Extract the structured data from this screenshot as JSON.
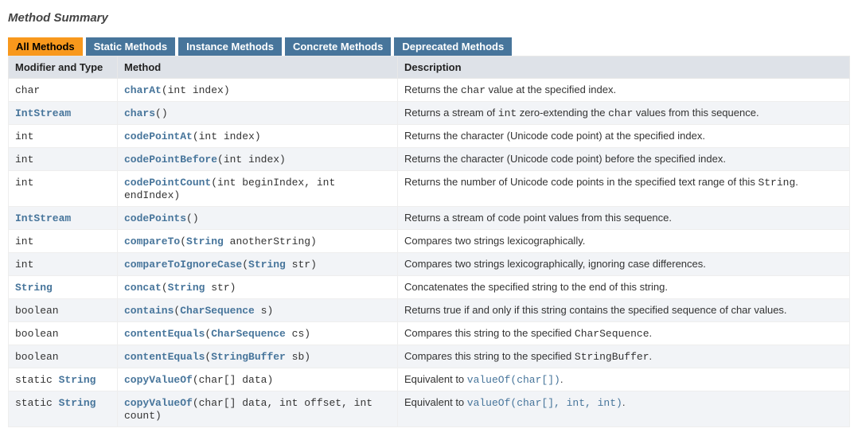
{
  "title": "Method Summary",
  "tabs": [
    {
      "label": "All Methods",
      "active": true
    },
    {
      "label": "Static Methods",
      "active": false
    },
    {
      "label": "Instance Methods",
      "active": false
    },
    {
      "label": "Concrete Methods",
      "active": false
    },
    {
      "label": "Deprecated Methods",
      "active": false
    }
  ],
  "headers": {
    "modifier": "Modifier and Type",
    "method": "Method",
    "description": "Description"
  },
  "rows": [
    {
      "modifier": [
        {
          "t": "char",
          "kind": "kw"
        }
      ],
      "method": {
        "name": "charAt",
        "sig": "(int index)",
        "params": []
      },
      "desc": [
        {
          "t": "Returns the "
        },
        {
          "t": "char",
          "code": true
        },
        {
          "t": " value at the specified index."
        }
      ]
    },
    {
      "modifier": [
        {
          "t": "IntStream",
          "kind": "link"
        }
      ],
      "method": {
        "name": "chars",
        "sig": "()",
        "params": []
      },
      "desc": [
        {
          "t": "Returns a stream of "
        },
        {
          "t": "int",
          "code": true
        },
        {
          "t": " zero-extending the "
        },
        {
          "t": "char",
          "code": true
        },
        {
          "t": " values from this sequence."
        }
      ]
    },
    {
      "modifier": [
        {
          "t": "int",
          "kind": "kw"
        }
      ],
      "method": {
        "name": "codePointAt",
        "sig": "(int index)",
        "params": []
      },
      "desc": [
        {
          "t": "Returns the character (Unicode code point) at the specified index."
        }
      ]
    },
    {
      "modifier": [
        {
          "t": "int",
          "kind": "kw"
        }
      ],
      "method": {
        "name": "codePointBefore",
        "sig": "(int index)",
        "params": []
      },
      "desc": [
        {
          "t": "Returns the character (Unicode code point) before the specified index."
        }
      ]
    },
    {
      "modifier": [
        {
          "t": "int",
          "kind": "kw"
        }
      ],
      "method": {
        "name": "codePointCount",
        "sig": "(int beginIndex, int endIndex)",
        "params": []
      },
      "desc": [
        {
          "t": "Returns the number of Unicode code points in the specified text range of this "
        },
        {
          "t": "String",
          "code": true
        },
        {
          "t": "."
        }
      ]
    },
    {
      "modifier": [
        {
          "t": "IntStream",
          "kind": "link"
        }
      ],
      "method": {
        "name": "codePoints",
        "sig": "()",
        "params": []
      },
      "desc": [
        {
          "t": "Returns a stream of code point values from this sequence."
        }
      ]
    },
    {
      "modifier": [
        {
          "t": "int",
          "kind": "kw"
        }
      ],
      "method": {
        "name": "compareTo",
        "sig": "",
        "params": [
          {
            "prefix": "(",
            "type": "String",
            "rest": " anotherString)"
          }
        ]
      },
      "desc": [
        {
          "t": "Compares two strings lexicographically."
        }
      ]
    },
    {
      "modifier": [
        {
          "t": "int",
          "kind": "kw"
        }
      ],
      "method": {
        "name": "compareToIgnoreCase",
        "sig": "",
        "params": [
          {
            "prefix": "(",
            "type": "String",
            "rest": " str)"
          }
        ]
      },
      "desc": [
        {
          "t": "Compares two strings lexicographically, ignoring case differences."
        }
      ]
    },
    {
      "modifier": [
        {
          "t": "String",
          "kind": "link"
        }
      ],
      "method": {
        "name": "concat",
        "sig": "",
        "params": [
          {
            "prefix": "(",
            "type": "String",
            "rest": " str)"
          }
        ]
      },
      "desc": [
        {
          "t": "Concatenates the specified string to the end of this string."
        }
      ]
    },
    {
      "modifier": [
        {
          "t": "boolean",
          "kind": "kw"
        }
      ],
      "method": {
        "name": "contains",
        "sig": "",
        "params": [
          {
            "prefix": "(",
            "type": "CharSequence",
            "rest": " s)"
          }
        ]
      },
      "desc": [
        {
          "t": "Returns true if and only if this string contains the specified sequence of char values."
        }
      ]
    },
    {
      "modifier": [
        {
          "t": "boolean",
          "kind": "kw"
        }
      ],
      "method": {
        "name": "contentEquals",
        "sig": "",
        "params": [
          {
            "prefix": "(",
            "type": "CharSequence",
            "rest": " cs)"
          }
        ]
      },
      "desc": [
        {
          "t": "Compares this string to the specified "
        },
        {
          "t": "CharSequence",
          "code": true
        },
        {
          "t": "."
        }
      ]
    },
    {
      "modifier": [
        {
          "t": "boolean",
          "kind": "kw"
        }
      ],
      "method": {
        "name": "contentEquals",
        "sig": "",
        "params": [
          {
            "prefix": "(",
            "type": "StringBuffer",
            "rest": " sb)"
          }
        ]
      },
      "desc": [
        {
          "t": "Compares this string to the specified "
        },
        {
          "t": "StringBuffer",
          "code": true
        },
        {
          "t": "."
        }
      ]
    },
    {
      "modifier": [
        {
          "t": "static ",
          "kind": "kw"
        },
        {
          "t": "String",
          "kind": "link"
        }
      ],
      "method": {
        "name": "copyValueOf",
        "sig": "(char[] data)",
        "params": []
      },
      "desc": [
        {
          "t": "Equivalent to "
        },
        {
          "t": "valueOf(char[])",
          "ref": true
        },
        {
          "t": "."
        }
      ]
    },
    {
      "modifier": [
        {
          "t": "static ",
          "kind": "kw"
        },
        {
          "t": "String",
          "kind": "link"
        }
      ],
      "method": {
        "name": "copyValueOf",
        "sig": "(char[] data, int offset, int count)",
        "params": []
      },
      "desc": [
        {
          "t": "Equivalent to "
        },
        {
          "t": "valueOf(char[], int, int)",
          "ref": true
        },
        {
          "t": "."
        }
      ]
    }
  ]
}
